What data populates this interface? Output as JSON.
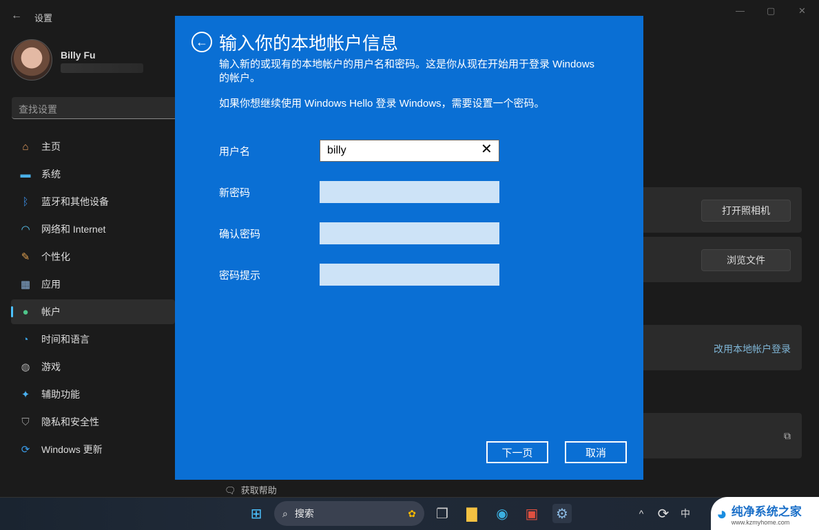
{
  "window": {
    "title": "设置",
    "back_icon": "arrow-left-icon",
    "minimize": "—",
    "maximize": "▢",
    "close": "✕"
  },
  "user": {
    "name": "Billy Fu"
  },
  "search": {
    "placeholder": "查找设置"
  },
  "sidebar": {
    "items": [
      {
        "label": "主页",
        "icon": "home-icon",
        "glyph": "⌂",
        "color": "#e8a060"
      },
      {
        "label": "系统",
        "icon": "monitor-icon",
        "glyph": "▬",
        "color": "#4ab0e8"
      },
      {
        "label": "蓝牙和其他设备",
        "icon": "bluetooth-icon",
        "glyph": "ᛒ",
        "color": "#3b8be0"
      },
      {
        "label": "网络和 Internet",
        "icon": "wifi-icon",
        "glyph": "◠",
        "color": "#5ac8f5"
      },
      {
        "label": "个性化",
        "icon": "brush-icon",
        "glyph": "✎",
        "color": "#e0a050"
      },
      {
        "label": "应用",
        "icon": "apps-icon",
        "glyph": "▦",
        "color": "#8ab0d8"
      },
      {
        "label": "帐户",
        "icon": "person-icon",
        "glyph": "●",
        "color": "#4ec58a",
        "active": true
      },
      {
        "label": "时间和语言",
        "icon": "clock-globe-icon",
        "glyph": "◔",
        "color": "#3aa0e0"
      },
      {
        "label": "游戏",
        "icon": "gamepad-icon",
        "glyph": "◍",
        "color": "#aaaaaa"
      },
      {
        "label": "辅助功能",
        "icon": "accessibility-icon",
        "glyph": "✦",
        "color": "#4ab0f0"
      },
      {
        "label": "隐私和安全性",
        "icon": "shield-icon",
        "glyph": "⛉",
        "color": "#999999"
      },
      {
        "label": "Windows 更新",
        "icon": "update-icon",
        "glyph": "⟳",
        "color": "#3a9be8"
      }
    ]
  },
  "right": {
    "camera_button": "打开照相机",
    "browse_button": "浏览文件",
    "local_link": "改用本地帐户登录",
    "external_icon": "external-link-icon"
  },
  "dialog": {
    "title": "输入你的本地帐户信息",
    "desc1": "输入新的或现有的本地帐户的用户名和密码。这是你从现在开始用于登录 Windows 的帐户。",
    "desc2": "如果你想继续使用 Windows Hello 登录 Windows，需要设置一个密码。",
    "fields": [
      {
        "label": "用户名",
        "value": "billy"
      },
      {
        "label": "新密码",
        "value": ""
      },
      {
        "label": "确认密码",
        "value": ""
      },
      {
        "label": "密码提示",
        "value": ""
      }
    ],
    "next": "下一页",
    "cancel": "取消",
    "accent": "#0a6fd4"
  },
  "help": {
    "label": "获取帮助"
  },
  "taskbar": {
    "search": "搜索",
    "ime": "中",
    "tray_up": "^"
  },
  "watermark": {
    "name": "纯净系统之家",
    "url": "www.kzmyhome.com"
  }
}
